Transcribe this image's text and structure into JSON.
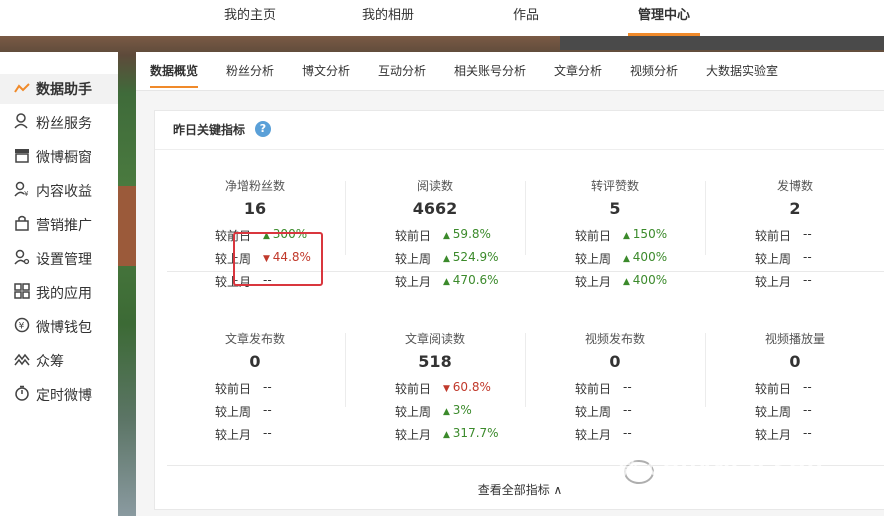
{
  "topnav": {
    "items": [
      {
        "label": "我的主页"
      },
      {
        "label": "我的相册"
      },
      {
        "label": "作品"
      },
      {
        "label": "管理中心"
      }
    ]
  },
  "sidebar": {
    "items": [
      {
        "label": "数据助手",
        "icon": "chart-line-icon"
      },
      {
        "label": "粉丝服务",
        "icon": "fans-icon"
      },
      {
        "label": "微博橱窗",
        "icon": "shop-icon"
      },
      {
        "label": "内容收益",
        "icon": "revenue-icon"
      },
      {
        "label": "营销推广",
        "icon": "bag-icon"
      },
      {
        "label": "设置管理",
        "icon": "settings-user-icon"
      },
      {
        "label": "我的应用",
        "icon": "apps-grid-icon"
      },
      {
        "label": "微博钱包",
        "icon": "wallet-icon"
      },
      {
        "label": "众筹",
        "icon": "crowdfund-icon"
      },
      {
        "label": "定时微博",
        "icon": "timer-icon"
      }
    ]
  },
  "tabs": [
    {
      "label": "数据概览"
    },
    {
      "label": "粉丝分析"
    },
    {
      "label": "博文分析"
    },
    {
      "label": "互动分析"
    },
    {
      "label": "相关账号分析"
    },
    {
      "label": "文章分析"
    },
    {
      "label": "视频分析"
    },
    {
      "label": "大数据实验室"
    }
  ],
  "card": {
    "title": "昨日关键指标",
    "help": "?",
    "cmp_labels": [
      "较前日",
      "较上周",
      "较上月"
    ],
    "view_all": "查看全部指标 ∧",
    "metrics": [
      {
        "label": "净增粉丝数",
        "value": "16",
        "cmp": [
          {
            "v": "300%",
            "dir": "up"
          },
          {
            "v": "44.8%",
            "dir": "down"
          },
          {
            "v": "--",
            "dir": "none"
          }
        ]
      },
      {
        "label": "阅读数",
        "value": "4662",
        "cmp": [
          {
            "v": "59.8%",
            "dir": "up"
          },
          {
            "v": "524.9%",
            "dir": "up"
          },
          {
            "v": "470.6%",
            "dir": "up"
          }
        ]
      },
      {
        "label": "转评赞数",
        "value": "5",
        "cmp": [
          {
            "v": "150%",
            "dir": "up"
          },
          {
            "v": "400%",
            "dir": "up"
          },
          {
            "v": "400%",
            "dir": "up"
          }
        ]
      },
      {
        "label": "发博数",
        "value": "2",
        "cmp": [
          {
            "v": "--",
            "dir": "none"
          },
          {
            "v": "--",
            "dir": "none"
          },
          {
            "v": "--",
            "dir": "none"
          }
        ]
      },
      {
        "label": "文章发布数",
        "value": "0",
        "cmp": [
          {
            "v": "--",
            "dir": "none"
          },
          {
            "v": "--",
            "dir": "none"
          },
          {
            "v": "--",
            "dir": "none"
          }
        ]
      },
      {
        "label": "文章阅读数",
        "value": "518",
        "cmp": [
          {
            "v": "60.8%",
            "dir": "down"
          },
          {
            "v": "3%",
            "dir": "up"
          },
          {
            "v": "317.7%",
            "dir": "up"
          }
        ]
      },
      {
        "label": "视频发布数",
        "value": "0",
        "cmp": [
          {
            "v": "--",
            "dir": "none"
          },
          {
            "v": "--",
            "dir": "none"
          },
          {
            "v": "--",
            "dir": "none"
          }
        ]
      },
      {
        "label": "视频播放量",
        "value": "0",
        "cmp": [
          {
            "v": "--",
            "dir": "none"
          },
          {
            "v": "--",
            "dir": "none"
          },
          {
            "v": "--",
            "dir": "none"
          }
        ]
      }
    ]
  },
  "watermark": "微 CHUANGJI SHU",
  "colors": {
    "accent": "#f08a2a",
    "up": "#3b8a2b",
    "down": "#c0392b",
    "highlight": "#d9363e"
  }
}
